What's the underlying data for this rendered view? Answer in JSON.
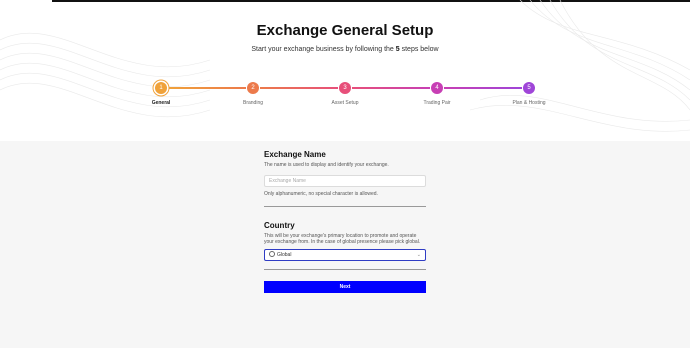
{
  "header": {
    "title": "Exchange General Setup",
    "subtitle_pre": "Start your exchange business by following the ",
    "subtitle_num": "5",
    "subtitle_post": " steps below"
  },
  "steps": [
    {
      "number": "1",
      "label": "General",
      "color": "#f0a23a",
      "active": true
    },
    {
      "number": "2",
      "label": "Branding",
      "color": "#ec7a4b"
    },
    {
      "number": "3",
      "label": "Asset Setup",
      "color": "#e74f7a"
    },
    {
      "number": "4",
      "label": "Trading Pair",
      "color": "#c73fb4"
    },
    {
      "number": "5",
      "label": "Plan & Hosting",
      "color": "#9f45d8"
    }
  ],
  "exchange_name": {
    "heading": "Exchange Name",
    "description": "The name is used to display and identify your exchange.",
    "placeholder": "Exchange Name",
    "hint": "Only alphanumeric, no special character is allowed."
  },
  "country": {
    "heading": "Country",
    "description": "This will be your exchange's primary location to promote and operate your exchange from. In the case of global presence please pick global.",
    "selected": "Global",
    "icon": "globe-icon"
  },
  "actions": {
    "next_label": "Next"
  }
}
